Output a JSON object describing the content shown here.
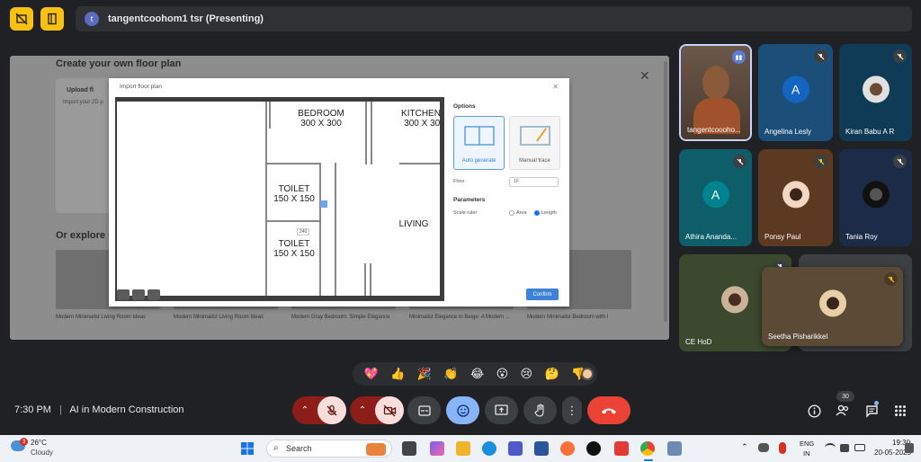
{
  "meeting": {
    "presenter_initial": "t",
    "presenter_label": "tangentcoohom1 tsr (Presenting)",
    "clock": "7:30 PM",
    "separator": "|",
    "title": "AI in Modern Construction",
    "participant_count": "30"
  },
  "shared_screen": {
    "heading": "Create your own floor plan",
    "upload_label": "Upload fl",
    "upload_hint": "Import your 2D p",
    "explore_heading": "Or explore C",
    "thumbs": [
      {
        "caption": "Modern Minimalist Living Room Ideas"
      },
      {
        "caption": "Modern Minimalist Living Room Ideas"
      },
      {
        "caption": "Modern Gray Bedroom: Simple Elegance"
      },
      {
        "caption": "Minimalist Elegance in Beige: A Modern ..."
      },
      {
        "caption": "Modern Minimalist Bedroom with I"
      }
    ],
    "dialog": {
      "title": "Import floor plan",
      "options_heading": "Options",
      "auto_generate": "Auto generate",
      "manual_trace": "Manual trace",
      "floor_label": "Floor",
      "floor_value": "1F",
      "parameters_heading": "Parameters",
      "scale_ruler_label": "Scale ruler",
      "area_label": "Area",
      "length_label": "Length",
      "confirm_label": "Confirm",
      "measure_value": "240",
      "rooms": {
        "bedroom": "BEDROOM",
        "bedroom_size": "300 X 300",
        "kitchen": "KITCHEN",
        "kitchen_size": "300 X 300",
        "toilet1": "TOILET",
        "toilet1_size": "150 X 150",
        "toilet2": "TOILET",
        "toilet2_size": "150 X 150",
        "living": "LIVING"
      }
    }
  },
  "participants": [
    {
      "name": "tangentcoooho...",
      "bg": "#4a3a2e"
    },
    {
      "name": "Angelina Lesly",
      "initial": "A",
      "bg": "#1c4e7a",
      "avatar_color": "#1565c0"
    },
    {
      "name": "Kiran Babu A R",
      "bg": "#0f3b57"
    },
    {
      "name": "Athira Ananda...",
      "initial": "A",
      "bg": "#0e5e6a",
      "avatar_color": "#00838f"
    },
    {
      "name": "Ponsy Paul",
      "bg": "#5c3a22"
    },
    {
      "name": "Tania Roy",
      "bg": "#1c2c48"
    },
    {
      "name": "CE HoD",
      "bg": "#3b4a2e"
    },
    {
      "name": "Seetha Pisharikkel",
      "bg": "#5a4a36"
    }
  ],
  "reactions": [
    "💖",
    "👍",
    "🎉",
    "👏",
    "😂",
    "😮",
    "😢",
    "🤔",
    "👎"
  ],
  "colors": {
    "accent_yellow": "#f9c00f",
    "end_call_red": "#ea4335",
    "muted_red": "#f28b82",
    "active_blue": "#8ab4f8"
  },
  "taskbar": {
    "temp": "26°C",
    "weather": "Cloudy",
    "weather_badge": "3",
    "search_placeholder": "Search",
    "lang_top": "ENG",
    "lang_bottom": "IN",
    "time": "19:30",
    "date": "20-05-2025"
  }
}
